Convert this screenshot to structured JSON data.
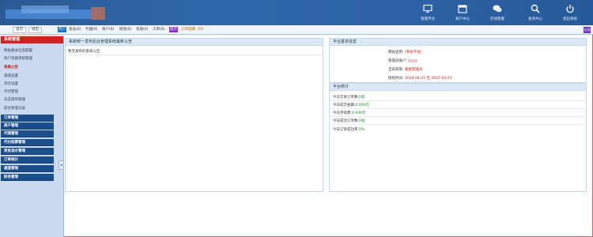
{
  "header": {
    "nav": [
      {
        "label": "管理平台",
        "icon": "monitor-icon"
      },
      {
        "label": "商户中心",
        "icon": "calendar-icon"
      },
      {
        "label": "在线客服",
        "icon": "chat-icon"
      },
      {
        "label": "查询中心",
        "icon": "search-icon"
      },
      {
        "label": "退出系统",
        "icon": "power-icon"
      }
    ]
  },
  "toolbar": {
    "home": "首页",
    "logout": "退出",
    "badge1": "开户",
    "items": [
      {
        "label": "会员(0)",
        "color": "#333"
      },
      {
        "label": "代理(0)",
        "color": "#333"
      },
      {
        "label": "商户(0)",
        "color": "#333"
      },
      {
        "label": "提现(0)",
        "color": "#333"
      },
      {
        "label": "充值(0)",
        "color": "#333"
      },
      {
        "label": "工单(0)",
        "color": "#333"
      }
    ],
    "badge2": "提示",
    "notice": "订单提醒: 0/0",
    "nv": "在线"
  },
  "sidebar": {
    "section": "系统管理",
    "items": [
      {
        "label": "网站基本信息配置",
        "active": false
      },
      {
        "label": "商户资质审核管理",
        "active": false
      },
      {
        "label": "系统公告",
        "active": true
      },
      {
        "label": "通道设置",
        "active": false
      },
      {
        "label": "风控设置",
        "active": false
      },
      {
        "label": "代付管理",
        "active": false
      },
      {
        "label": "日志操作管理",
        "active": false
      },
      {
        "label": "后台管理记录",
        "active": false
      }
    ],
    "groups": [
      "订单管理",
      "商户管理",
      "代理管理",
      "代付结算管理",
      "资金流水管理",
      "订单统计",
      "通道管理",
      "财务管理"
    ],
    "collapse": "◂"
  },
  "notice_panel": {
    "title": "系统统一发布后台管理系统最新公告",
    "empty": "暂无发布的系统公告"
  },
  "info_panel": {
    "title": "平台基本信息",
    "rows": [
      {
        "label": "网站名称:",
        "value": "(系统平台)",
        "cls": "red"
      },
      {
        "label": "管理员账户:",
        "value": "",
        "cls": "blur"
      },
      {
        "label": "当前权限:",
        "value": "超级管理员",
        "cls": "red"
      },
      {
        "label": "授权时间:",
        "value": "2019-04-25 至 2037-04-25",
        "cls": "red"
      }
    ]
  },
  "stats_panel": {
    "title": "平台统计",
    "rows": [
      {
        "label": "今日交易订单数:",
        "value": "0笔",
        "cls": "green"
      },
      {
        "label": "今日成交金额:",
        "value": "0.000元",
        "cls": "green"
      },
      {
        "label": "今日手续费:",
        "value": "0.000元",
        "cls": "green"
      },
      {
        "label": "今日成功订单数:",
        "value": "0笔",
        "cls": "green"
      },
      {
        "label": "今日订单成功率:",
        "value": "0%",
        "cls": "green"
      }
    ]
  }
}
